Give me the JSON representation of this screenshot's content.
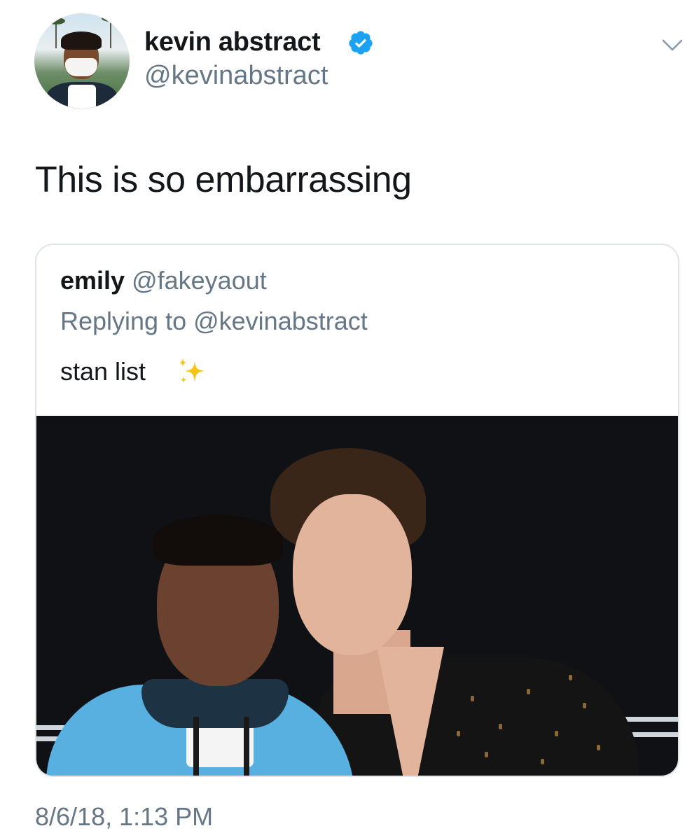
{
  "author": {
    "display_name": "kevin abstract",
    "handle": "@kevinabstract",
    "verified": true
  },
  "tweet": {
    "text": "This is so embarrassing",
    "timestamp": "8/6/18, 1:13 PM"
  },
  "quoted_tweet": {
    "name": "emily",
    "handle": "@fakeyaout",
    "reply_context": "Replying to @kevinabstract",
    "text": "stan list",
    "emoji_icon": "sparkles-icon"
  },
  "icons": {
    "verified": "verified-badge-icon",
    "menu": "chevron-down-icon"
  },
  "colors": {
    "primary_text": "#14171a",
    "secondary_text": "#657786",
    "verified_blue": "#1da1f2",
    "card_border": "#dfe5ea"
  }
}
